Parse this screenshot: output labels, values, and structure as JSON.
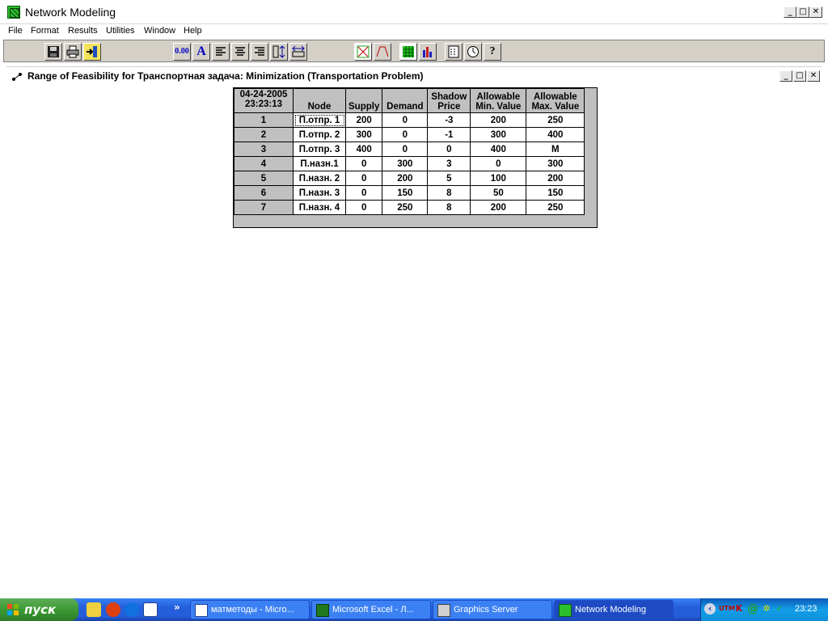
{
  "app": {
    "title": "Network Modeling",
    "window_buttons": [
      "_",
      "□",
      "✕"
    ]
  },
  "menu": {
    "items": [
      {
        "label": "File"
      },
      {
        "label": "Format"
      },
      {
        "label": "Results"
      },
      {
        "label": "Utilities"
      },
      {
        "label": "Window"
      },
      {
        "label": "Help"
      }
    ]
  },
  "toolbar": {
    "decimal_label": "0.00",
    "font_label": "A",
    "buttons": [
      {
        "icon": "save-icon"
      },
      {
        "icon": "print-icon"
      },
      {
        "icon": "exit-icon"
      },
      {
        "icon": "decimal-icon"
      },
      {
        "icon": "font-icon"
      },
      {
        "icon": "align-left-icon"
      },
      {
        "icon": "align-center-icon"
      },
      {
        "icon": "align-right-icon"
      },
      {
        "icon": "row-height-icon"
      },
      {
        "icon": "column-width-icon"
      },
      {
        "icon": "network-graph-icon"
      },
      {
        "icon": "chart-graph-icon"
      },
      {
        "icon": "grid-icon"
      },
      {
        "icon": "bar-chart-icon"
      },
      {
        "icon": "calculator-icon"
      },
      {
        "icon": "clock-icon"
      },
      {
        "icon": "help-icon"
      }
    ]
  },
  "child_window": {
    "title": "Range of Feasibility for Транспортная задача: Minimization (Transportation Problem)"
  },
  "table": {
    "corner_date": "04-24-2005",
    "corner_time": "23:23:13",
    "headers": [
      {
        "line1": "",
        "line2": "Node"
      },
      {
        "line1": "",
        "line2": "Supply"
      },
      {
        "line1": "",
        "line2": "Demand"
      },
      {
        "line1": "Shadow",
        "line2": "Price"
      },
      {
        "line1": "Allowable",
        "line2": "Min. Value"
      },
      {
        "line1": "Allowable",
        "line2": "Max. Value"
      }
    ],
    "rows": [
      {
        "index": "1",
        "node": "П.отпр. 1",
        "supply": "200",
        "demand": "0",
        "shadow": "-3",
        "min": "200",
        "max": "250"
      },
      {
        "index": "2",
        "node": "П.отпр. 2",
        "supply": "300",
        "demand": "0",
        "shadow": "-1",
        "min": "300",
        "max": "400"
      },
      {
        "index": "3",
        "node": "П.отпр. 3",
        "supply": "400",
        "demand": "0",
        "shadow": "0",
        "min": "400",
        "max": "M"
      },
      {
        "index": "4",
        "node": "П.назн.1",
        "supply": "0",
        "demand": "300",
        "shadow": "3",
        "min": "0",
        "max": "300"
      },
      {
        "index": "5",
        "node": "П.назн. 2",
        "supply": "0",
        "demand": "200",
        "shadow": "5",
        "min": "100",
        "max": "200"
      },
      {
        "index": "6",
        "node": "П.назн. 3",
        "supply": "0",
        "demand": "150",
        "shadow": "8",
        "min": "50",
        "max": "150"
      },
      {
        "index": "7",
        "node": "П.назн. 4",
        "supply": "0",
        "demand": "250",
        "shadow": "8",
        "min": "200",
        "max": "250"
      }
    ]
  },
  "taskbar": {
    "start_label": "пуск",
    "more_label": "»",
    "items": [
      {
        "label": "матметоды - Micro...",
        "icon": "word-icon"
      },
      {
        "label": "Microsoft Excel - Л...",
        "icon": "excel-icon"
      },
      {
        "label": "Graphics Server",
        "icon": "graphics-server-icon"
      },
      {
        "label": "Network Modeling",
        "icon": "network-modeling-icon"
      }
    ],
    "clock": "23:23",
    "tray_utm": "UTM"
  },
  "colors": {
    "grid_gray": "#c0c0c0",
    "toolbar_gray": "#d4d0c8",
    "taskbar_blue": "#245edb",
    "start_green": "#3c9a34"
  }
}
